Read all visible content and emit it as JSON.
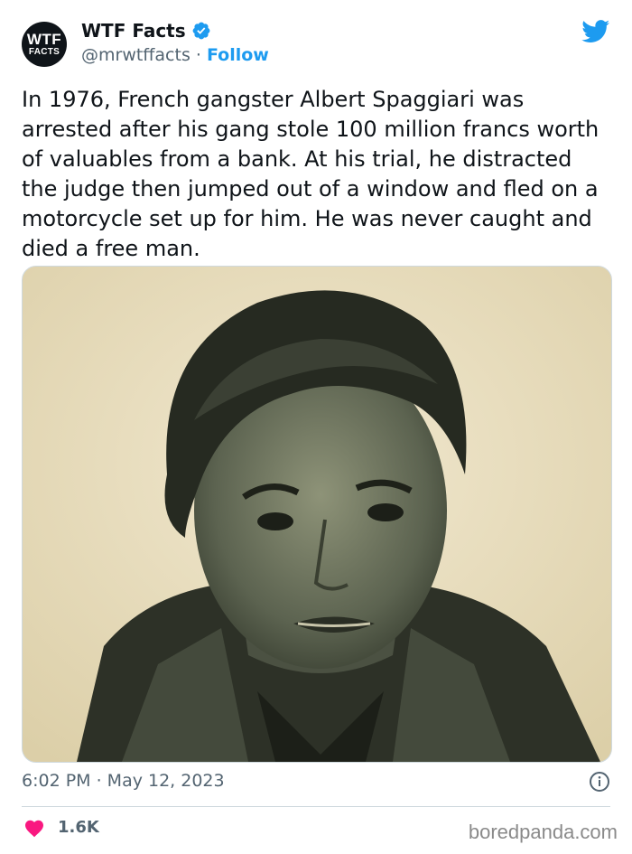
{
  "account": {
    "avatar_line1": "WTF",
    "avatar_line2": "FACTS",
    "name": "WTF Facts",
    "handle": "@mrwtffacts",
    "separator": " · ",
    "follow_label": "Follow"
  },
  "tweet": {
    "text": "In 1976, French gangster Albert Spaggiari was arrested after his gang stole 100 million francs worth of valuables from a bank. At his trial, he distracted the judge then jumped out of a window and fled on a motorcycle set up for him. He was never caught and died a free man.",
    "timestamp": "6:02 PM · May 12, 2023"
  },
  "engagement": {
    "likes": "1.6K"
  },
  "footer": {
    "credit": "boredpanda.com"
  },
  "colors": {
    "accent": "#1d9bf0",
    "like": "#f91880",
    "muted": "#536471",
    "photo_bg": "#ede2c6"
  },
  "icons": [
    "verified-badge-icon",
    "twitter-bird-icon",
    "info-icon",
    "heart-icon"
  ]
}
